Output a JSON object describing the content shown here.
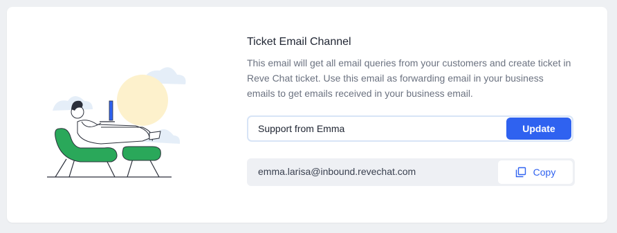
{
  "channel": {
    "title": "Ticket Email Channel",
    "description": "This email will get all email queries from your customers and create ticket in Reve Chat ticket. Use this email as forwarding email in your business emails to get emails received in your business email.",
    "name_input": {
      "value": "Support from Emma",
      "placeholder": ""
    },
    "update_label": "Update",
    "email": "emma.larisa@inbound.revechat.com",
    "copy_label": "Copy"
  },
  "colors": {
    "accent": "#2f62f0",
    "chair": "#2aa85a",
    "sun": "#fdf1cc",
    "cloud": "#e5eef8"
  },
  "icons": {
    "illustration": "person-relaxing-with-laptop",
    "copy": "copy-icon"
  }
}
